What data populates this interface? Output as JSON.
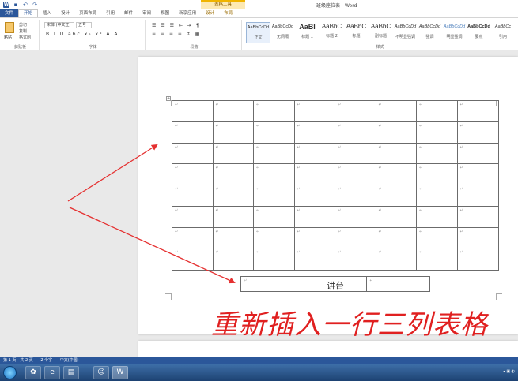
{
  "titlebar": {
    "doc_title": "班级座位表 - Word",
    "context_tools": "表格工具"
  },
  "tabs": [
    "文件",
    "开始",
    "插入",
    "设计",
    "页面布局",
    "引用",
    "邮件",
    "审阅",
    "视图",
    "新享应用",
    "设计",
    "布局"
  ],
  "ribbon": {
    "clipboard": {
      "paste": "粘贴",
      "cut": "剪切",
      "copy": "复制",
      "format_painter": "格式刷",
      "label": "剪贴板"
    },
    "font": {
      "name": "宋体 (中文正)",
      "size": "五号",
      "label": "字体"
    },
    "paragraph": {
      "label": "段落"
    },
    "styles": {
      "label": "样式",
      "items": [
        {
          "sample": "AaBbCcDd",
          "name": "正文"
        },
        {
          "sample": "AaBbCcDd",
          "name": "无间隔"
        },
        {
          "sample": "AaBl",
          "name": "标题 1"
        },
        {
          "sample": "AaBbC",
          "name": "标题 2"
        },
        {
          "sample": "AaBbC",
          "name": "标题"
        },
        {
          "sample": "AaBbC",
          "name": "副标题"
        },
        {
          "sample": "AaBbCcDd",
          "name": "不明显强调"
        },
        {
          "sample": "AaBbCcDd",
          "name": "强调"
        },
        {
          "sample": "AaBbCcDd",
          "name": "明显强调"
        },
        {
          "sample": "AaBbCcDd",
          "name": "要点"
        },
        {
          "sample": "AaBbCc",
          "name": "引用"
        }
      ]
    }
  },
  "document": {
    "cell_mark": "↵",
    "podium_label": "讲台",
    "caption": "重新插入一行三列表格"
  },
  "statusbar": {
    "page": "第 1 页，共 2 页",
    "words": "2 个字",
    "lang": "中文(中国)"
  }
}
